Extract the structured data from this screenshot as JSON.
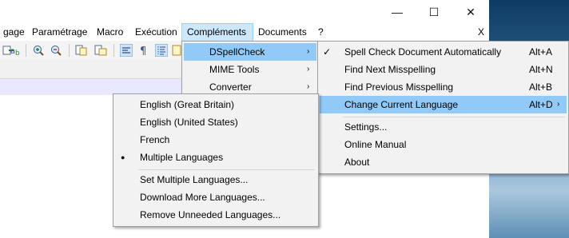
{
  "menubar": {
    "items": [
      "gage",
      "Paramétrage",
      "Macro",
      "Exécution",
      "Compléments",
      "Documents",
      "?"
    ],
    "close_glyph": "X"
  },
  "window": {
    "minimize": "—",
    "maximize": "☐",
    "close": "✕"
  },
  "complements_menu": {
    "items": [
      {
        "label": "DSpellCheck",
        "arrow": "›"
      },
      {
        "label": "MIME Tools",
        "arrow": "›"
      },
      {
        "label": "Converter",
        "arrow": "›"
      }
    ]
  },
  "dspell_menu": {
    "items": [
      {
        "label": "Spell Check Document Automatically",
        "shortcut": "Alt+A",
        "checked": true
      },
      {
        "label": "Find Next Misspelling",
        "shortcut": "Alt+N"
      },
      {
        "label": "Find Previous Misspelling",
        "shortcut": "Alt+B"
      },
      {
        "label": "Change Current Language",
        "shortcut": "Alt+D",
        "arrow": "›"
      },
      {
        "label": "Settings..."
      },
      {
        "label": "Online Manual"
      },
      {
        "label": "About"
      }
    ],
    "check_glyph": "✓"
  },
  "language_menu": {
    "items": [
      {
        "label": "English (Great Britain)"
      },
      {
        "label": "English (United States)"
      },
      {
        "label": "French"
      },
      {
        "label": "Multiple Languages",
        "selected": true
      },
      {
        "label": "Set Multiple Languages..."
      },
      {
        "label": "Download More Languages..."
      },
      {
        "label": "Remove Unneeded Languages..."
      }
    ],
    "bullet_glyph": "●"
  },
  "colors": {
    "highlight": "#91c9f7",
    "menu_bg": "#f2f2f2",
    "menubar_active": "#cce8ff"
  }
}
